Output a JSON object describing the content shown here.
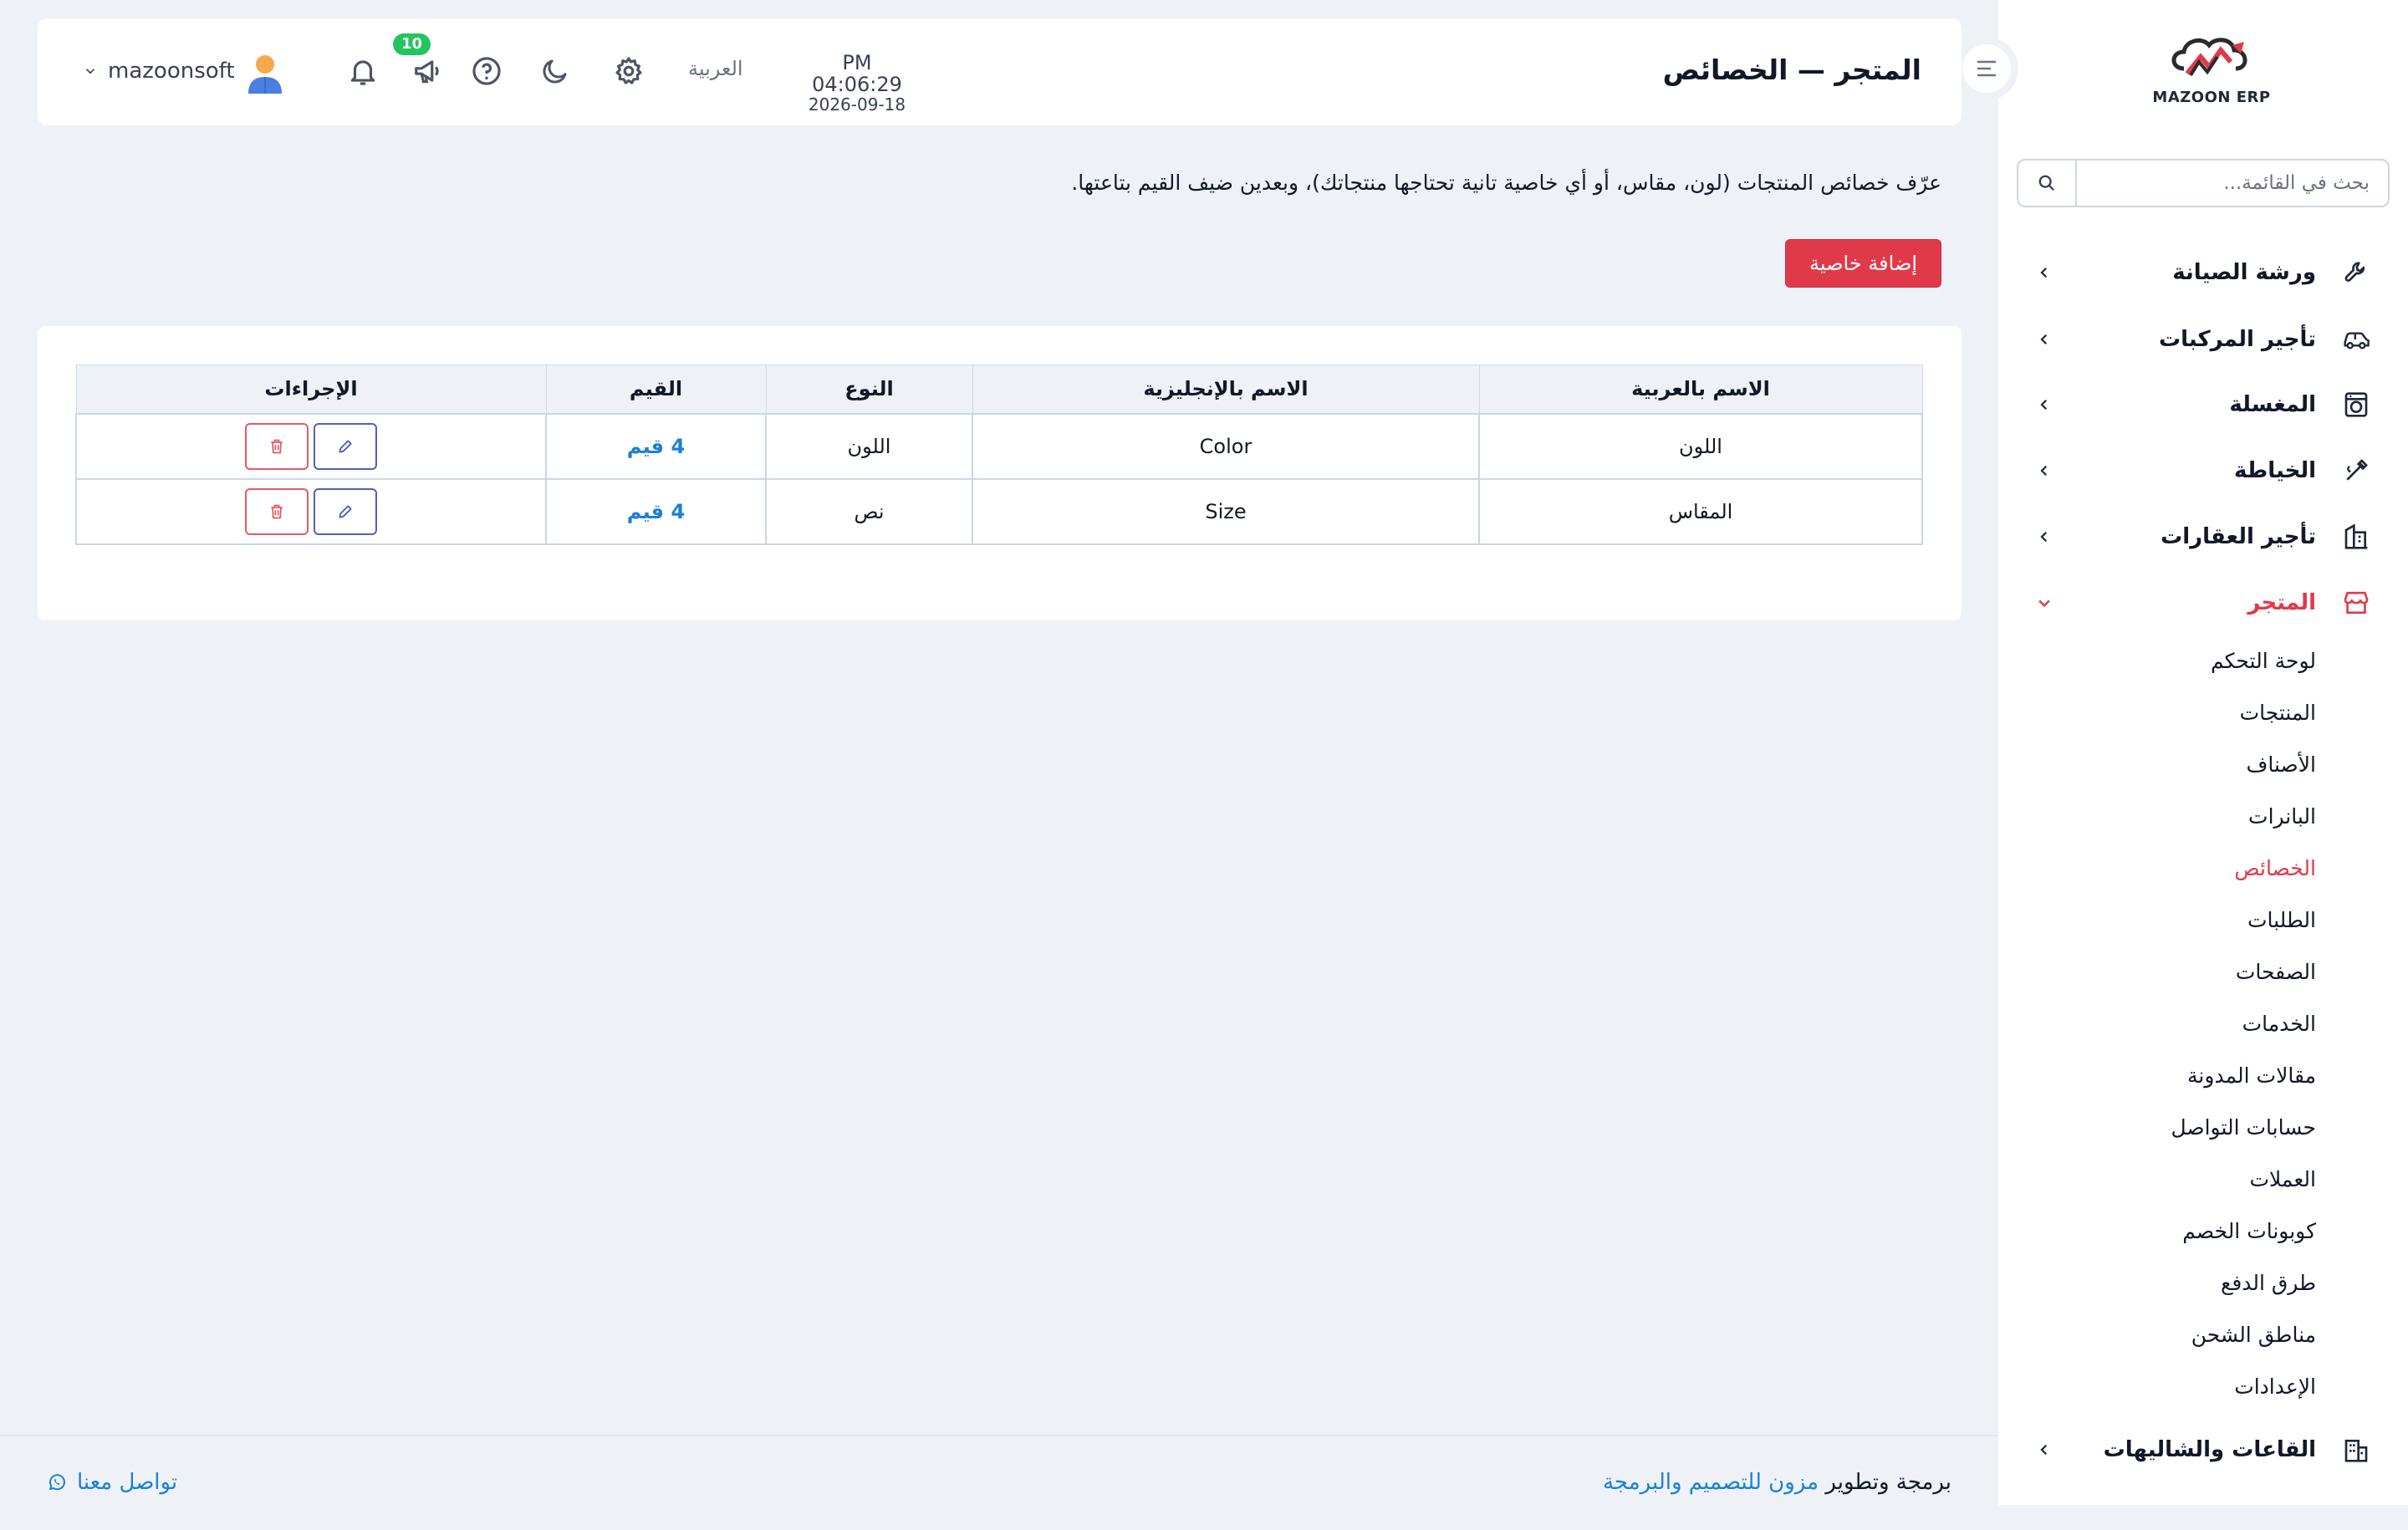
{
  "brand": {
    "name": "MAZOON ERP",
    "tagline": "ERP مزون"
  },
  "sidebar": {
    "search_placeholder": "بحث في القائمة...",
    "items": [
      {
        "label": "ورشة الصيانة",
        "icon": "wrench-icon"
      },
      {
        "label": "تأجير المركبات",
        "icon": "car-icon"
      },
      {
        "label": "المغسلة",
        "icon": "washing-machine-icon"
      },
      {
        "label": "الخياطة",
        "icon": "needle-icon"
      },
      {
        "label": "تأجير العقارات",
        "icon": "building-icon"
      },
      {
        "label": "المتجر",
        "icon": "store-icon",
        "expanded": true
      },
      {
        "label": "القاعات والشاليهات",
        "icon": "hall-icon"
      }
    ],
    "store_submenu": [
      "لوحة التحكم",
      "المنتجات",
      "الأصناف",
      "البانرات",
      "الخصائص",
      "الطلبات",
      "الصفحات",
      "الخدمات",
      "مقالات المدونة",
      "حسابات التواصل",
      "العملات",
      "كوبونات الخصم",
      "طرق الدفع",
      "مناطق الشحن",
      "الإعدادات"
    ],
    "active_submenu": "الخصائص"
  },
  "header": {
    "title": "المتجر — الخصائص",
    "time": "PM 04:06:29",
    "date": "2026-09-18",
    "language": "العربية",
    "notification_count": "10",
    "username": "mazoonsoft"
  },
  "main": {
    "intro": "عرّف خصائص المنتجات (لون، مقاس، أو أي خاصية تانية تحتاجها منتجاتك)، وبعدين ضيف القيم بتاعتها.",
    "add_button": "إضافة خاصية",
    "table": {
      "headers": [
        "الاسم بالعربية",
        "الاسم بالإنجليزية",
        "النوع",
        "القيم",
        "الإجراءات"
      ],
      "rows": [
        {
          "name_ar": "اللون",
          "name_en": "Color",
          "type": "اللون",
          "values": "4 قيم"
        },
        {
          "name_ar": "المقاس",
          "name_en": "Size",
          "type": "نص",
          "values": "4 قيم"
        }
      ]
    }
  },
  "footer": {
    "credit_prefix": "برمجة وتطوير",
    "credit_company": "مزون للتصميم والبرمجة",
    "contact": "تواصل معنا"
  },
  "colors": {
    "accent": "#e03a4a",
    "link": "#1d7fd6",
    "badge": "#22c55e",
    "background": "#eef2f7"
  }
}
